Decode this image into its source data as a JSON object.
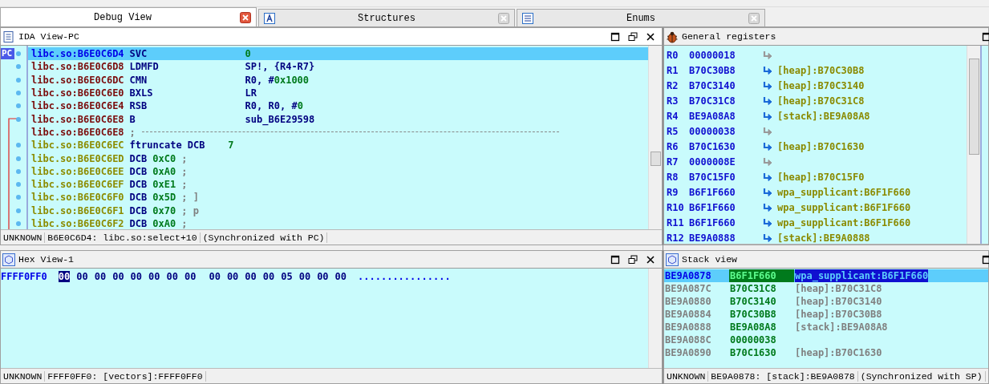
{
  "tabs": [
    {
      "label": "Debug View",
      "kind": "plain",
      "selected": true
    },
    {
      "label": "Structures",
      "kind": "struct",
      "selected": false
    },
    {
      "label": "Enums",
      "kind": "enum",
      "selected": false
    }
  ],
  "ida_view": {
    "title": "IDA View-PC",
    "pc_marker": "PC",
    "lines": [
      {
        "kind": "current",
        "addr": "libc.so:B6E0C6D4",
        "mnem": "SVC",
        "operands": [
          {
            "text": "0",
            "kind": "num"
          }
        ]
      },
      {
        "kind": "code",
        "addr": "libc.so:B6E0C6D8",
        "mnem": "LDMFD",
        "operands": [
          {
            "text": "SP!, {R4-R7}",
            "kind": "reg"
          }
        ]
      },
      {
        "kind": "code",
        "addr": "libc.so:B6E0C6DC",
        "mnem": "CMN",
        "operands": [
          {
            "text": "R0, #",
            "kind": "reg"
          },
          {
            "text": "0x1000",
            "kind": "num"
          }
        ]
      },
      {
        "kind": "code",
        "addr": "libc.so:B6E0C6E0",
        "mnem": "BXLS",
        "operands": [
          {
            "text": "LR",
            "kind": "reg"
          }
        ]
      },
      {
        "kind": "code",
        "addr": "libc.so:B6E0C6E4",
        "mnem": "RSB",
        "operands": [
          {
            "text": "R0, R0, #",
            "kind": "reg"
          },
          {
            "text": "0",
            "kind": "num"
          }
        ]
      },
      {
        "kind": "code",
        "addr": "libc.so:B6E0C6E8",
        "mnem": "B",
        "operands": [
          {
            "text": "sub_B6E29598",
            "kind": "reg"
          }
        ]
      },
      {
        "kind": "separator",
        "addr": "libc.so:B6E0C6E8",
        "mnem": ";"
      },
      {
        "kind": "data",
        "addr": "libc.so:B6E0C6EC",
        "mnem": "ftruncate DCB",
        "operands": [
          {
            "text": "   7",
            "kind": "num"
          }
        ]
      },
      {
        "kind": "data",
        "addr": "libc.so:B6E0C6ED",
        "mnem": "DCB",
        "operands": [
          {
            "text": "0xC0",
            "kind": "num"
          },
          {
            "text": ";",
            "kind": "comment"
          }
        ]
      },
      {
        "kind": "data",
        "addr": "libc.so:B6E0C6EE",
        "mnem": "DCB",
        "operands": [
          {
            "text": "0xA0",
            "kind": "num"
          },
          {
            "text": ";",
            "kind": "comment"
          }
        ]
      },
      {
        "kind": "data",
        "addr": "libc.so:B6E0C6EF",
        "mnem": "DCB",
        "operands": [
          {
            "text": "0xE1",
            "kind": "num"
          },
          {
            "text": ";",
            "kind": "comment"
          }
        ]
      },
      {
        "kind": "data",
        "addr": "libc.so:B6E0C6F0",
        "mnem": "DCB",
        "operands": [
          {
            "text": "0x5D",
            "kind": "num"
          },
          {
            "text": "; ]",
            "kind": "comment"
          }
        ]
      },
      {
        "kind": "data",
        "addr": "libc.so:B6E0C6F1",
        "mnem": "DCB",
        "operands": [
          {
            "text": "0x70",
            "kind": "num"
          },
          {
            "text": "; p",
            "kind": "comment"
          }
        ]
      },
      {
        "kind": "data",
        "addr": "libc.so:B6E0C6F2",
        "mnem": "DCB",
        "operands": [
          {
            "text": "0xA0",
            "kind": "num"
          },
          {
            "text": ";",
            "kind": "comment"
          }
        ]
      }
    ],
    "status": [
      "UNKNOWN",
      "B6E0C6D4: libc.so:select+10",
      "(Synchronized with PC)"
    ]
  },
  "registers": {
    "title": "General registers",
    "rows": [
      {
        "name": "R0",
        "value": "00000018"
      },
      {
        "name": "R1",
        "value": "B70C30B8",
        "target": "[heap]:B70C30B8"
      },
      {
        "name": "R2",
        "value": "B70C3140",
        "target": "[heap]:B70C3140"
      },
      {
        "name": "R3",
        "value": "B70C31C8",
        "target": "[heap]:B70C31C8"
      },
      {
        "name": "R4",
        "value": "BE9A08A8",
        "target": "[stack]:BE9A08A8"
      },
      {
        "name": "R5",
        "value": "00000038"
      },
      {
        "name": "R6",
        "value": "B70C1630",
        "target": "[heap]:B70C1630"
      },
      {
        "name": "R7",
        "value": "0000008E"
      },
      {
        "name": "R8",
        "value": "B70C15F0",
        "target": "[heap]:B70C15F0"
      },
      {
        "name": "R9",
        "value": "B6F1F660",
        "target": "wpa_supplicant:B6F1F660"
      },
      {
        "name": "R10",
        "value": "B6F1F660",
        "target": "wpa_supplicant:B6F1F660"
      },
      {
        "name": "R11",
        "value": "B6F1F660",
        "target": "wpa_supplicant:B6F1F660"
      },
      {
        "name": "R12",
        "value": "BE9A0888",
        "target": "[stack]:BE9A0888"
      }
    ]
  },
  "hex_view": {
    "title": "Hex View-1",
    "addr": "FFFF0FF0",
    "bytes": [
      {
        "text": "00",
        "selected": true
      },
      {
        "text": "00",
        "selected": false
      },
      {
        "text": "00",
        "selected": false
      },
      {
        "text": "00",
        "selected": false
      },
      {
        "text": "00",
        "selected": false
      },
      {
        "text": "00",
        "selected": false
      },
      {
        "text": "00",
        "selected": false
      },
      {
        "text": "00",
        "selected": false
      },
      {
        "text": "00",
        "selected": false
      },
      {
        "text": "00",
        "selected": false
      },
      {
        "text": "00",
        "selected": false
      },
      {
        "text": "00",
        "selected": false
      },
      {
        "text": "05",
        "selected": false
      },
      {
        "text": "00",
        "selected": false
      },
      {
        "text": "00",
        "selected": false
      },
      {
        "text": "00",
        "selected": false
      }
    ],
    "ascii": "................",
    "status": [
      "UNKNOWN",
      "FFFF0FF0: [vectors]:FFFF0FF0"
    ]
  },
  "stack_view": {
    "title": "Stack view",
    "rows": [
      {
        "addr": "BE9A0878",
        "value": "B6F1F660",
        "comment": "wpa_supplicant:B6F1F660",
        "selected": true
      },
      {
        "addr": "BE9A087C",
        "value": "B70C31C8",
        "comment": "[heap]:B70C31C8",
        "selected": false
      },
      {
        "addr": "BE9A0880",
        "value": "B70C3140",
        "comment": "[heap]:B70C3140",
        "selected": false
      },
      {
        "addr": "BE9A0884",
        "value": "B70C30B8",
        "comment": "[heap]:B70C30B8",
        "selected": false
      },
      {
        "addr": "BE9A0888",
        "value": "BE9A08A8",
        "comment": "[stack]:BE9A08A8",
        "selected": false
      },
      {
        "addr": "BE9A088C",
        "value": "00000038",
        "selected": false
      },
      {
        "addr": "BE9A0890",
        "value": "B70C1630",
        "comment": "[heap]:B70C1630",
        "selected": false
      }
    ],
    "status": [
      "UNKNOWN",
      "BE9A0878: [stack]:BE9A0878",
      "(Synchronized with SP)"
    ]
  }
}
